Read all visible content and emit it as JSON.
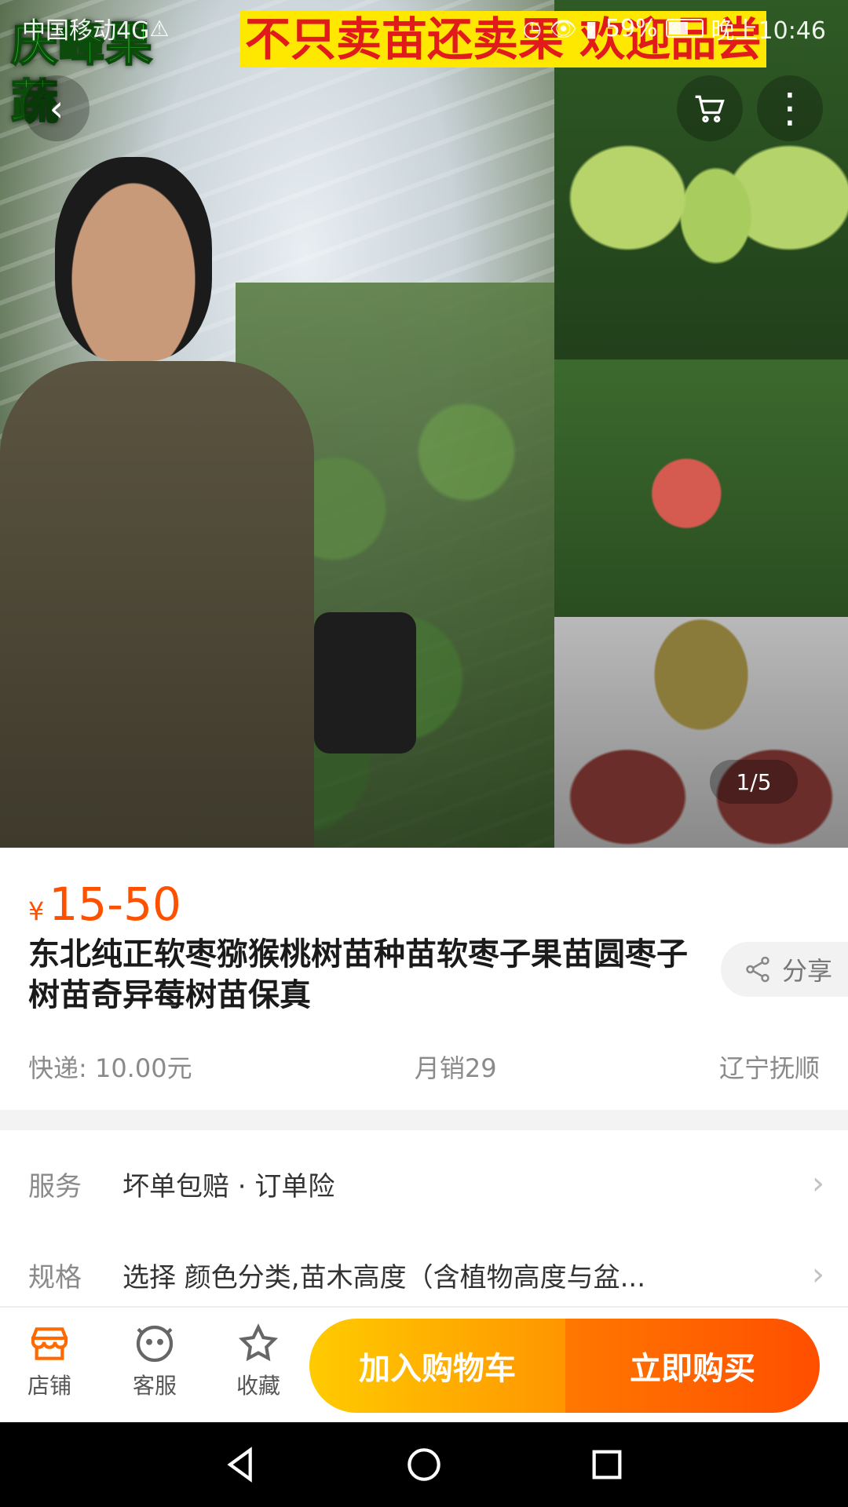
{
  "status_bar": {
    "carrier": "中国移动4G",
    "warning_icon": "warning-icon",
    "battery": "59%",
    "time": "晚上10:46"
  },
  "hero": {
    "logo_text": "庆峰果蔬",
    "slogan": "不只卖苗还卖果 欢迎品尝",
    "page_indicator": "1/5"
  },
  "icons": {
    "back": "‹",
    "cart": "🛒",
    "more": "⋮",
    "share": "⎋",
    "chevron": "›"
  },
  "product": {
    "currency": "¥",
    "price": "15-50",
    "title": "东北纯正软枣猕猴桃树苗种苗软枣子果苗圆枣子树苗奇异莓树苗保真",
    "share_label": "分享",
    "shipping": "快递: 10.00元",
    "monthly_sales": "月销29",
    "location": "辽宁抚顺"
  },
  "details": {
    "service_label": "服务",
    "service_value": "坏单包赔 · 订单险",
    "spec_label": "规格",
    "spec_value": "选择 颜色分类,苗木高度（含植物高度与盆..."
  },
  "action_bar": {
    "store_label": "店铺",
    "service_label": "客服",
    "favorite_label": "收藏",
    "add_cart_label": "加入购物车",
    "buy_now_label": "立即购买"
  },
  "colors": {
    "price": "#ff5000",
    "cart_button": "#ffb000",
    "buy_button": "#ff5a00"
  }
}
